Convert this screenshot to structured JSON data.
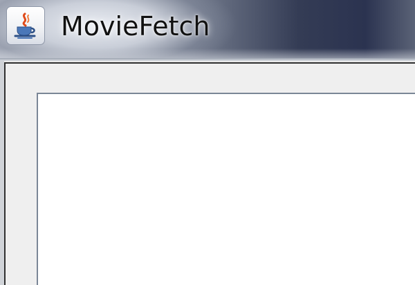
{
  "window": {
    "title": "MovieFetch",
    "icon": "java-coffee-cup-icon"
  }
}
